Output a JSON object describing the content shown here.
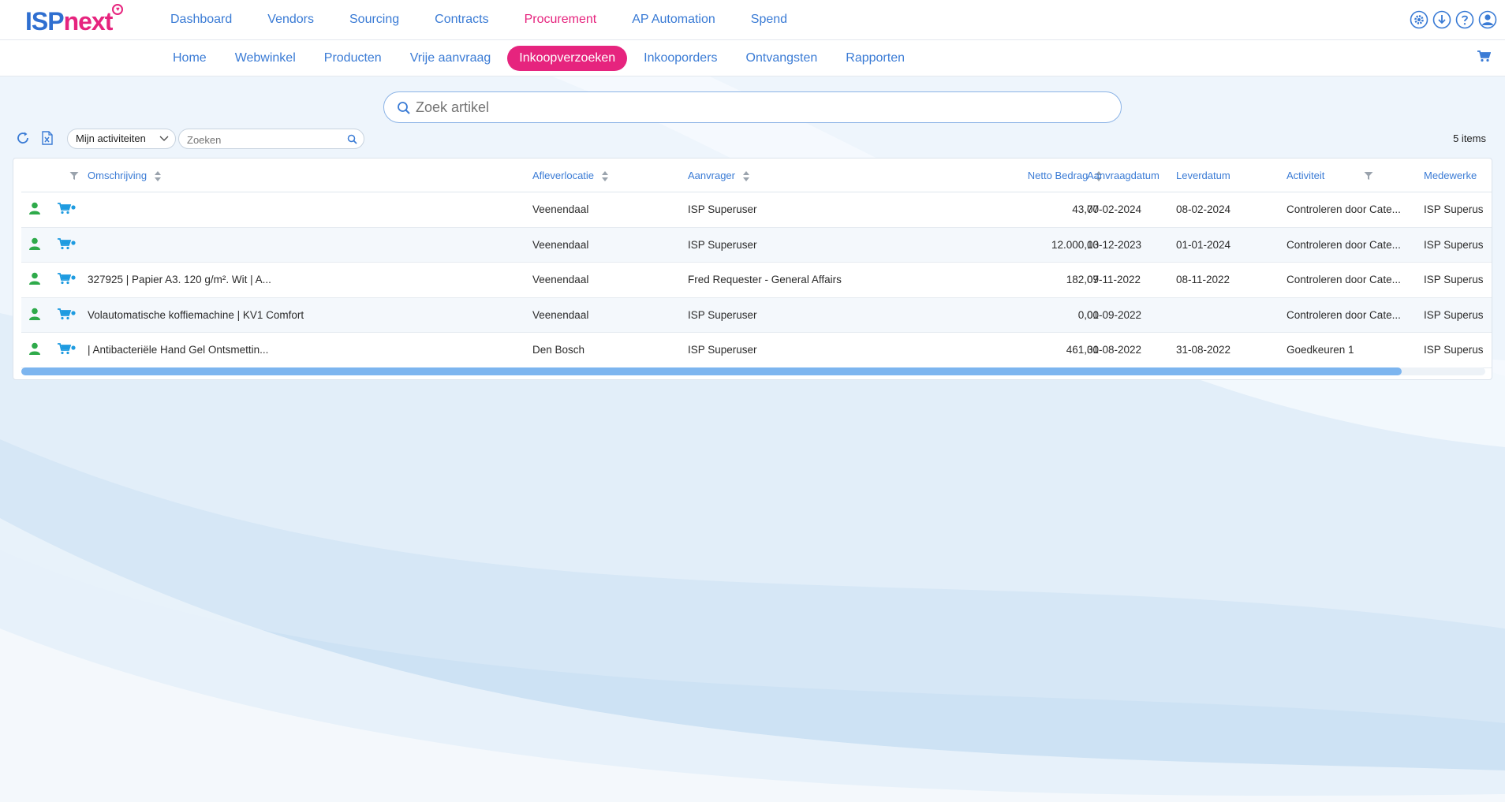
{
  "app": {
    "logo_primary": "ISP",
    "logo_secondary": "next"
  },
  "main_nav": [
    {
      "label": "Dashboard"
    },
    {
      "label": "Vendors"
    },
    {
      "label": "Sourcing"
    },
    {
      "label": "Contracts"
    },
    {
      "label": "Procurement",
      "active": true
    },
    {
      "label": "AP Automation"
    },
    {
      "label": "Spend"
    }
  ],
  "top_icons": [
    "gear-icon",
    "download-icon",
    "help-icon",
    "user-icon"
  ],
  "sub_nav": [
    {
      "label": "Home"
    },
    {
      "label": "Webwinkel"
    },
    {
      "label": "Producten"
    },
    {
      "label": "Vrije aanvraag"
    },
    {
      "label": "Inkoopverzoeken",
      "active": true
    },
    {
      "label": "Inkooporders"
    },
    {
      "label": "Ontvangsten"
    },
    {
      "label": "Rapporten"
    }
  ],
  "search": {
    "placeholder": "Zoek artikel"
  },
  "toolbar": {
    "activity_filter": "Mijn activiteiten",
    "filter_placeholder": "Zoeken",
    "item_count": "5 items"
  },
  "table": {
    "columns": {
      "description": "Omschrijving",
      "location": "Afleverlocatie",
      "requester": "Aanvrager",
      "net_amount": "Netto Bedrag",
      "request_date": "Aanvraagdatum",
      "delivery_date": "Leverdatum",
      "activity": "Activiteit",
      "employee": "Medewerke"
    },
    "rows": [
      {
        "description": "",
        "location": "Veenendaal",
        "requester": "ISP Superuser",
        "net_amount": "43,70",
        "request_date": "07-02-2024",
        "delivery_date": "08-02-2024",
        "activity": "Controleren door Cate...",
        "employee": "ISP Superus"
      },
      {
        "description": "",
        "location": "Veenendaal",
        "requester": "ISP Superuser",
        "net_amount": "12.000,00",
        "request_date": "13-12-2023",
        "delivery_date": "01-01-2024",
        "activity": "Controleren door Cate...",
        "employee": "ISP Superus"
      },
      {
        "description": "327925 | Papier A3. 120 g/m². Wit | A...",
        "location": "Veenendaal",
        "requester": "Fred Requester - General Affairs",
        "net_amount": "182,09",
        "request_date": "07-11-2022",
        "delivery_date": "08-11-2022",
        "activity": "Controleren door Cate...",
        "employee": "ISP Superus"
      },
      {
        "description": "Volautomatische koffiemachine | KV1 Comfort",
        "location": "Veenendaal",
        "requester": "ISP Superuser",
        "net_amount": "0,00",
        "request_date": "01-09-2022",
        "delivery_date": "",
        "activity": "Controleren door Cate...",
        "employee": "ISP Superus"
      },
      {
        "description": "| Antibacteriële Hand Gel Ontsmettin...",
        "location": "Den Bosch",
        "requester": "ISP Superuser",
        "net_amount": "461,01",
        "request_date": "30-08-2022",
        "delivery_date": "31-08-2022",
        "activity": "Goedkeuren 1",
        "employee": "ISP Superus"
      }
    ]
  },
  "colors": {
    "brand_blue": "#3a7bd5",
    "brand_pink": "#e6247e",
    "status_green": "#2eaa4a",
    "cart_blue": "#1e9be0"
  }
}
